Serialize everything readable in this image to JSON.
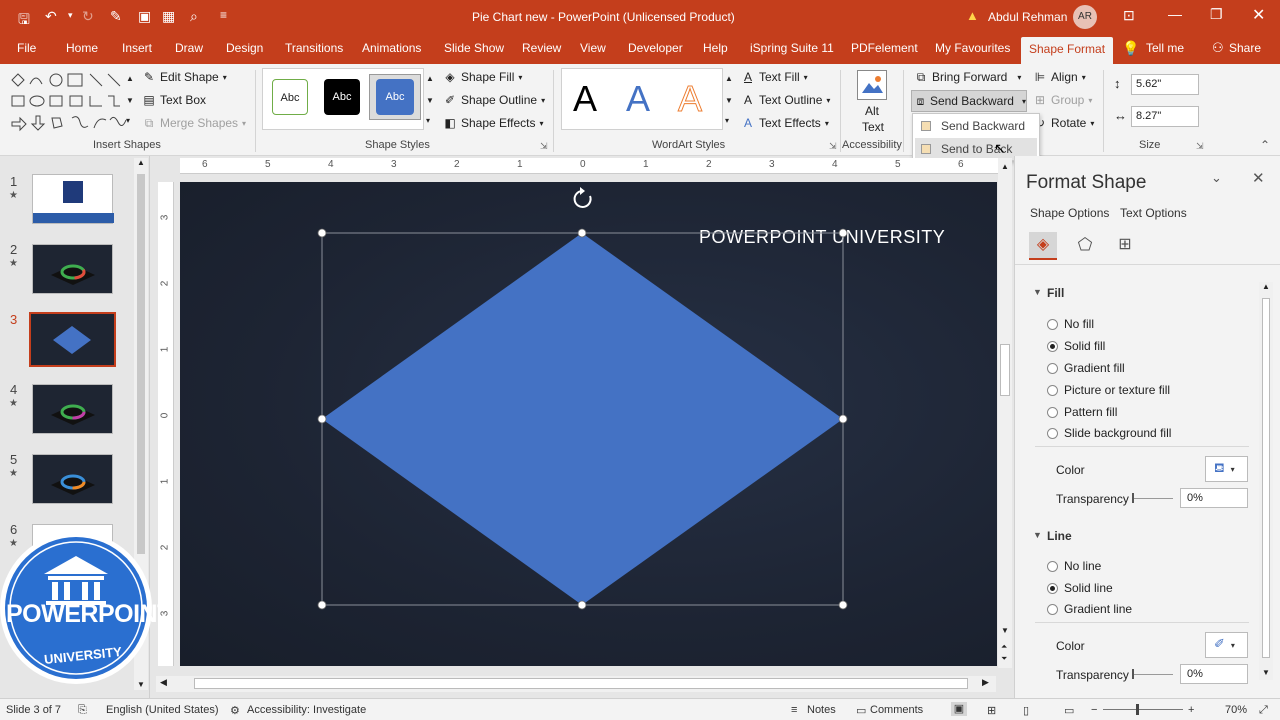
{
  "titlebar": {
    "title": "Pie Chart new  -  PowerPoint (Unlicensed Product)",
    "user": "Abdul Rehman",
    "user_initials": "AR",
    "warning_icon": "warning-icon",
    "accent": "#c43e1c"
  },
  "tabs": [
    "File",
    "Home",
    "Insert",
    "Draw",
    "Design",
    "Transitions",
    "Animations",
    "Slide Show",
    "Review",
    "View",
    "Developer",
    "Help",
    "iSpring Suite 11",
    "PDFelement",
    "My Favourites",
    "Shape Format"
  ],
  "tell_me": "Tell me",
  "share": "Share",
  "ribbon": {
    "insert_shapes": {
      "label": "Insert Shapes",
      "edit_shape": "Edit Shape",
      "text_box": "Text Box",
      "merge_shapes": "Merge Shapes"
    },
    "shape_styles": {
      "label": "Shape Styles",
      "swatch1": "Abc",
      "swatch2": "Abc",
      "swatch3": "Abc",
      "shape_fill": "Shape Fill",
      "shape_outline": "Shape Outline",
      "shape_effects": "Shape Effects"
    },
    "wordart": {
      "label": "WordArt Styles",
      "a1": "A",
      "a2": "A",
      "a3": "A",
      "text_fill": "Text Fill",
      "text_outline": "Text Outline",
      "text_effects": "Text Effects"
    },
    "accessibility": {
      "label": "Accessibility",
      "alt_text_1": "Alt",
      "alt_text_2": "Text"
    },
    "arrange": {
      "bring_forward": "Bring Forward",
      "send_backward": "Send Backward",
      "align": "Align",
      "group": "Group",
      "rotate": "Rotate"
    },
    "size": {
      "label": "Size",
      "height": "5.62\"",
      "width": "8.27\""
    }
  },
  "dropdown": {
    "items": [
      "Send Backward",
      "Send to Back"
    ]
  },
  "slides": [
    {
      "num": "1",
      "star": "★"
    },
    {
      "num": "2",
      "star": "★"
    },
    {
      "num": "3",
      "star": ""
    },
    {
      "num": "4",
      "star": "★"
    },
    {
      "num": "5",
      "star": "★"
    },
    {
      "num": "6",
      "star": "★"
    }
  ],
  "ruler_top": [
    "6",
    "5",
    "4",
    "3",
    "2",
    "1",
    "0",
    "1",
    "2",
    "3",
    "4",
    "5",
    "6"
  ],
  "ruler_left": [
    "3",
    "2",
    "1",
    "0",
    "1",
    "2",
    "3"
  ],
  "slide": {
    "heading": "POWERPOINT UNIVERSITY",
    "shape_color": "#4472c4"
  },
  "logo": {
    "line1": "POWERPOINT",
    "line2": "UNIVERSITY"
  },
  "pane": {
    "title": "Format Shape",
    "tab1": "Shape Options",
    "tab2": "Text Options",
    "fill_header": "Fill",
    "fill_options": [
      "No fill",
      "Solid fill",
      "Gradient fill",
      "Picture or texture fill",
      "Pattern fill",
      "Slide background fill"
    ],
    "fill_selected": "Solid fill",
    "color_label": "Color",
    "transparency_label": "Transparency",
    "transparency_value": "0%",
    "line_header": "Line",
    "line_options": [
      "No line",
      "Solid line",
      "Gradient line"
    ],
    "line_selected": "Solid line",
    "line_color_label": "Color",
    "line_transparency_label": "Transparency",
    "line_transparency_value": "0%"
  },
  "status": {
    "slide": "Slide 3 of 7",
    "language": "English (United States)",
    "accessibility": "Accessibility: Investigate",
    "notes": "Notes",
    "comments": "Comments",
    "zoom": "70%"
  }
}
